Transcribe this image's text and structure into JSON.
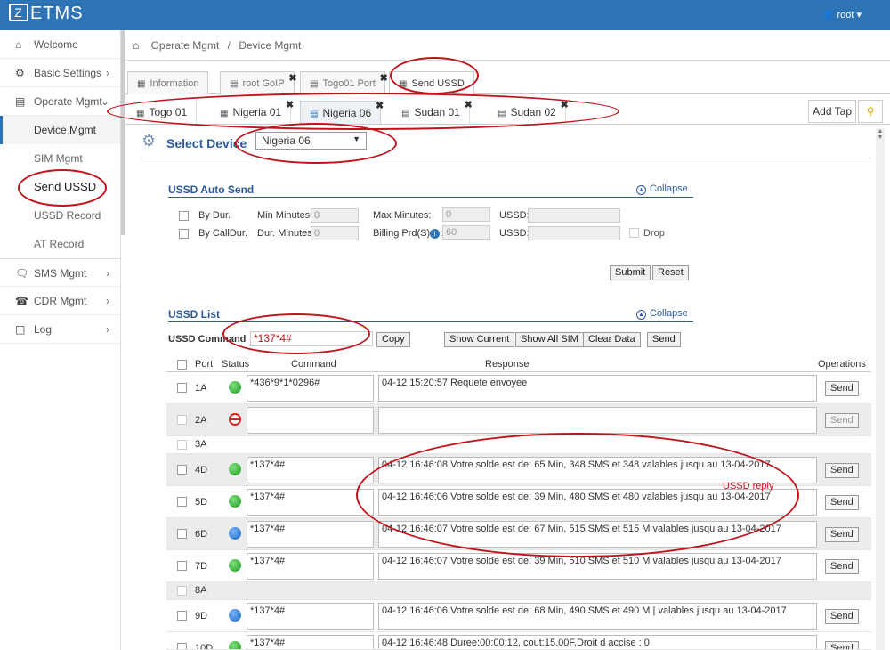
{
  "app": {
    "logo_mark": "Z",
    "title": "ETMS",
    "user": "root"
  },
  "sidebar": {
    "items": [
      {
        "label": "Welcome",
        "icon": "home-icon"
      },
      {
        "label": "Basic Settings",
        "icon": "gear-icon"
      },
      {
        "label": "Operate Mgmt",
        "icon": "list-icon"
      },
      {
        "label": "SMS Mgmt",
        "icon": "chat-icon"
      },
      {
        "label": "CDR Mgmt",
        "icon": "phone-icon"
      },
      {
        "label": "Log",
        "icon": "log-icon"
      }
    ],
    "subitems": [
      "Device Mgmt",
      "SIM Mgmt",
      "Send USSD",
      "USSD Record",
      "AT Record"
    ]
  },
  "breadcrumb": {
    "part1": "Operate Mgmt",
    "sep": "/",
    "part2": "Device Mgmt"
  },
  "tabs": [
    "Information",
    "root GoIP",
    "Togo01 Port",
    "Send USSD"
  ],
  "device_tabs": [
    "Togo 01",
    "Nigeria 01",
    "Nigeria 06",
    "Sudan 01",
    "Sudan 02"
  ],
  "add_tap": "Add Tap",
  "select_device": {
    "label": "Select Device",
    "value": "Nigeria 06"
  },
  "auto_send": {
    "title": "USSD Auto Send",
    "collapse": "Collapse",
    "by_dur": "By Dur.",
    "by_calldur": "By CallDur.",
    "min_minutes": "Min Minutes:",
    "min_minutes_val": "0",
    "dur_minutes": "Dur. Minutes:",
    "dur_minutes_val": "0",
    "max_minutes": "Max Minutes:",
    "max_minutes_val": "0",
    "billing": "Billing Prd(S)",
    "billing_sep": ":",
    "billing_val": "60",
    "ussd": "USSD:",
    "drop": "Drop",
    "submit": "Submit",
    "reset": "Reset"
  },
  "ussd_list": {
    "title": "USSD List",
    "collapse": "Collapse",
    "command_label": "USSD Command",
    "command_value": "*137*4#",
    "copy": "Copy",
    "show_current": "Show Current",
    "show_all_sim": "Show All SIM",
    "clear_data": "Clear Data",
    "send": "Send"
  },
  "table": {
    "headers": {
      "port": "Port",
      "status": "Status",
      "command": "Command",
      "response": "Response",
      "operations": "Operations"
    },
    "rows": [
      {
        "port": "1A",
        "status": "green",
        "command": "*436*9*1*0296#",
        "response": "04-12 15:20:57 Requete envoyee",
        "send": "Send"
      },
      {
        "port": "2A",
        "status": "red",
        "command": "",
        "response": "",
        "send": "Send"
      },
      {
        "port": "3A"
      },
      {
        "port": "4D",
        "status": "green",
        "command": "*137*4#",
        "response": "04-12 16:46:08 Votre solde est de: 65 Min, 348 SMS et 348  valables jusqu au 13-04-2017",
        "send": "Send"
      },
      {
        "port": "5D",
        "status": "green",
        "command": "*137*4#",
        "response": "04-12 16:46:06 Votre solde est de: 39 Min, 480 SMS et 480  valables jusqu au 13-04-2017",
        "send": "Send"
      },
      {
        "port": "6D",
        "status": "blue",
        "command": "*137*4#",
        "response": "04-12 16:46:07 Votre solde est de: 67 Min, 515 SMS et 515 M   valables jusqu au 13-04-2017",
        "send": "Send"
      },
      {
        "port": "7D",
        "status": "green",
        "command": "*137*4#",
        "response": "04-12 16:46:07 Votre solde est de: 39 Min, 510 SMS et 510 M valables jusqu au 13-04-2017",
        "send": "Send"
      },
      {
        "port": "8A"
      },
      {
        "port": "9D",
        "status": "blue",
        "command": "*137*4#",
        "response": "04-12 16:46:06 Votre solde est de: 68 Min, 490 SMS et 490 M | valables jusqu au 13-04-2017",
        "send": "Send"
      },
      {
        "port": "10D",
        "status": "green",
        "command": "*137*4#",
        "response": "04-12 16:46:48 Duree:00:00:12, cout:15.00F,Droit d accise : 0",
        "send": "Send"
      }
    ]
  },
  "annotation": "USSD reply"
}
